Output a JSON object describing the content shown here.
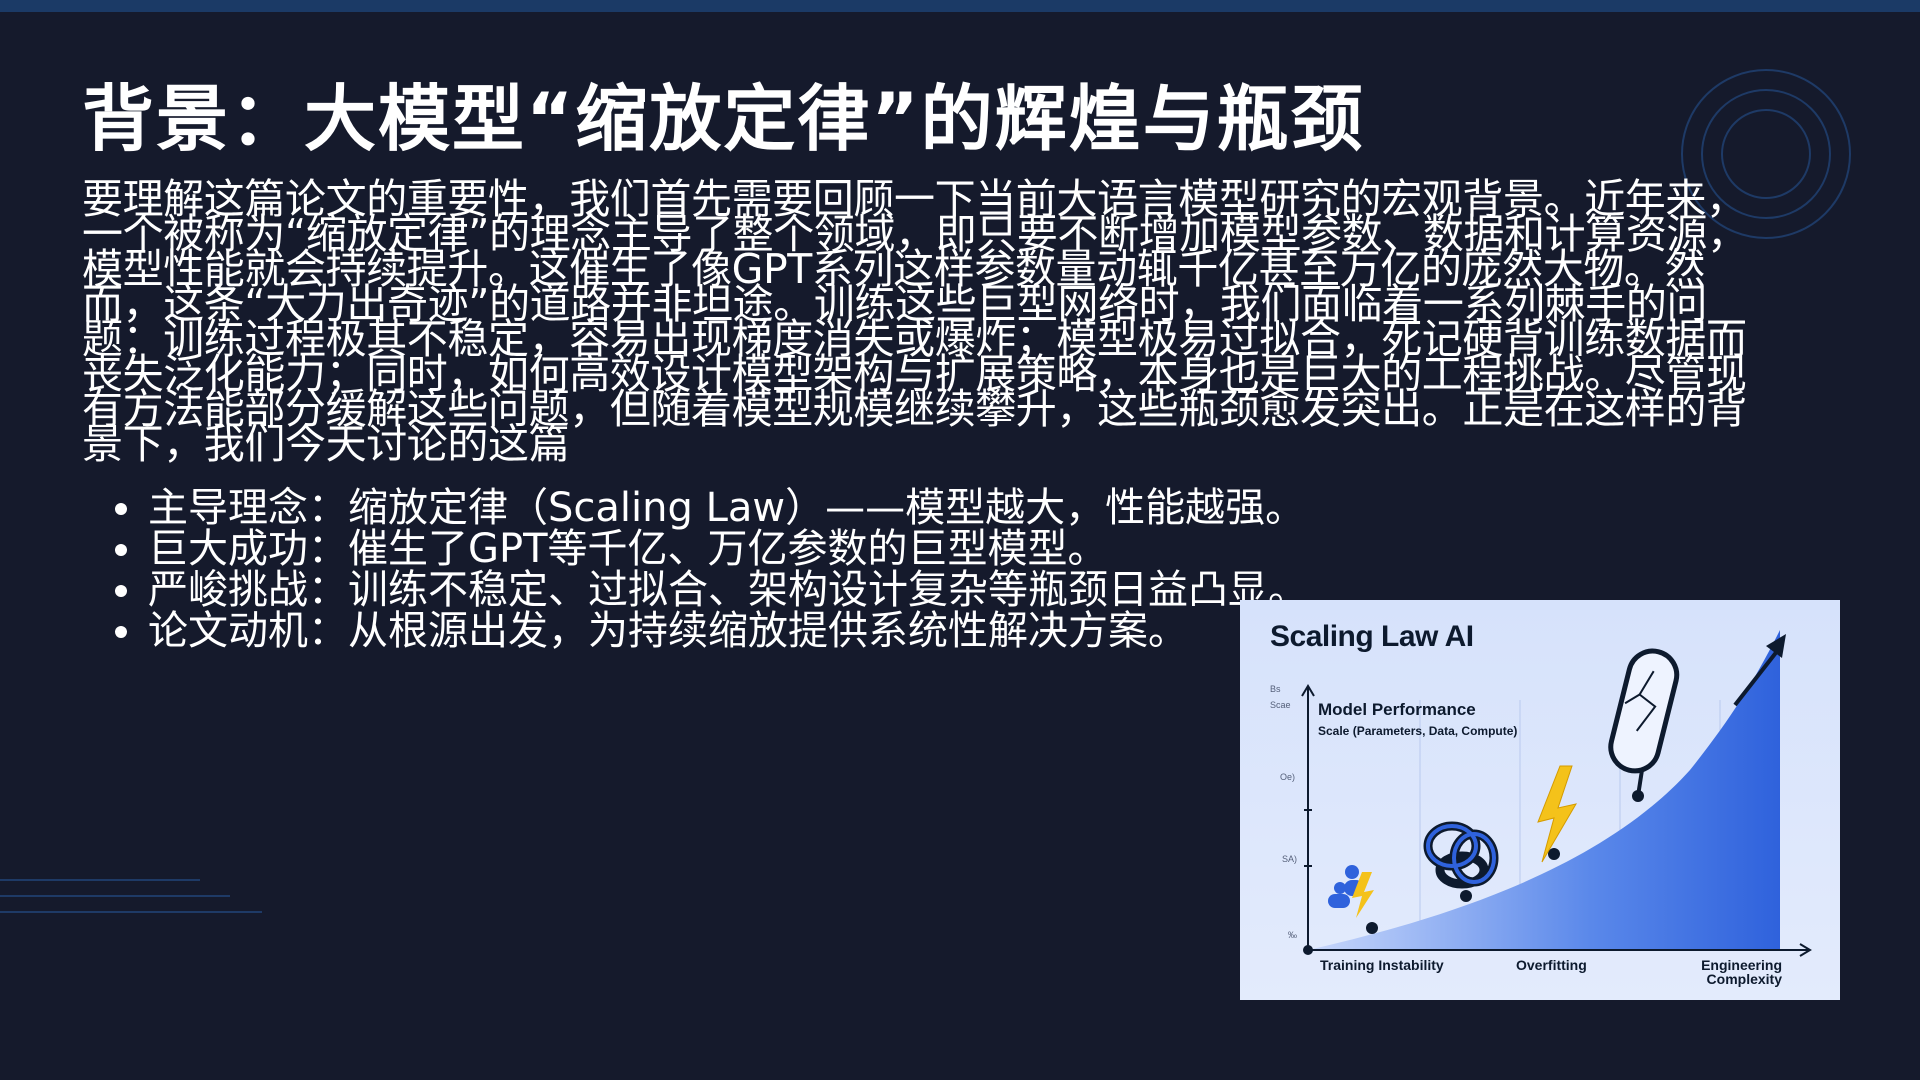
{
  "slide": {
    "title": "背景：大模型“缩放定律”的辉煌与瓶颈",
    "paragraph": "要理解这篇论文的重要性，我们首先需要回顾一下当前大语言模型研究的宏观背景。近年来，一个被称为“缩放定律”的理念主导了整个领域，即只要不断增加模型参数、数据和计算资源，模型性能就会持续提升。这催生了像GPT系列这样参数量动辄千亿甚至万亿的庞然大物。然而，这条“大力出奇迹”的道路并非坦途。训练这些巨型网络时，我们面临着一系列棘手的问题：训练过程极其不稳定，容易出现梯度消失或爆炸；模型极易过拟合，死记硬背训练数据而丧失泛化能力；同时，如何高效设计模型架构与扩展策略，本身也是巨大的工程挑战。尽管现有方法能部分缓解这些问题，但随着模型规模继续攀升，这些瓶颈愈发突出。正是在这样的背景下，我们今天讨论的这篇",
    "bullets": [
      "主导理念：缩放定律（Scaling Law）——模型越大，性能越强。",
      "巨大成功：催生了GPT等千亿、万亿参数的巨型模型。",
      "严峻挑战：训练不稳定、过拟合、架构设计复杂等瓶颈日益凸显。",
      "论文动机：从根源出发，为持续缩放提供系统性解决方案。"
    ]
  },
  "figure": {
    "title": "Scaling Law AI",
    "ylabel": "Model Performance",
    "ysub": "Scale (Parameters, Data, Compute)",
    "y_ticks": [
      "Bs",
      "Scae",
      "Oe)",
      "SA)",
      "‰"
    ],
    "x_categories": [
      "Training Instability",
      "Overfitting",
      "Engineering Complexity"
    ],
    "icons": [
      "people-icon",
      "lightning-icon",
      "tangle-knot-icon",
      "lightning-icon",
      "cracked-mirror-icon",
      "arrow-up-icon"
    ],
    "colors": {
      "curve_fill": "#3d6fe0",
      "axis": "#0d1a2e",
      "lightning": "#f4c21a",
      "background": "#151a2c",
      "accent": "#1b3a66"
    }
  }
}
